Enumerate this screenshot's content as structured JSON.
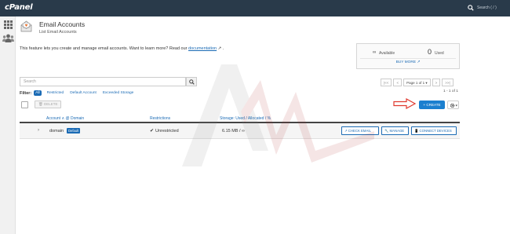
{
  "topbar": {
    "logo": "cPanel",
    "search_label": "Search ( / )"
  },
  "header": {
    "title": "Email Accounts",
    "subtitle": "List Email Accounts"
  },
  "intro": {
    "text": "This feature lets you create and manage email accounts. Want to learn more? Read our ",
    "link": "documentation",
    "link_suffix": " ↗ ."
  },
  "stats": {
    "available_icon": "∞",
    "available_label": "Available",
    "used_value": "0",
    "used_label": "Used",
    "buy_more": "BUY MORE ↗"
  },
  "search": {
    "placeholder": "Search"
  },
  "filter": {
    "label": "Filter:",
    "all": "All",
    "options": [
      "Restricted",
      "Default Account",
      "Exceeded Storage"
    ]
  },
  "pager": {
    "first": "|<<",
    "prev": "<",
    "page": "Page 1 of 1 ▾",
    "next": ">",
    "last": ">>|",
    "count": "1 - 1 of 1"
  },
  "toolbar": {
    "delete_label": "🗑 DELETE",
    "create_label": "+ CREATE",
    "gear_caret": "▾"
  },
  "table": {
    "headers": {
      "account": "Account ∧ @ Domain",
      "restrictions": "Restrictions",
      "storage": "Storage: Used / Allocated / %"
    },
    "rows": [
      {
        "chevron": "›",
        "domain": "domain",
        "badge": "Default",
        "restriction_icon": "✔",
        "restriction": "Unrestricted",
        "storage": "6.15 MB / ∞",
        "actions": {
          "check": "↗ CHECK EMAIL",
          "manage": "🔧 MANAGE",
          "connect": "📱 CONNECT DEVICES"
        }
      }
    ]
  },
  "colors": {
    "topbar": "#293a4a",
    "accent": "#1b6bb5",
    "create": "#1b7fcf",
    "hint_arrow": "#e03a2f"
  }
}
